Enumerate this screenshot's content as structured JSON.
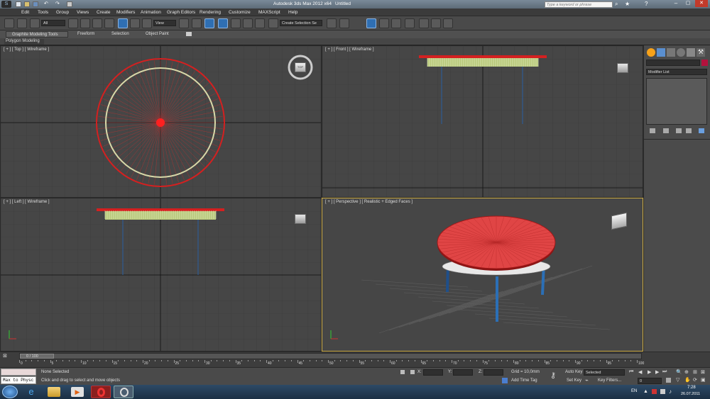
{
  "title": {
    "app": "Autodesk 3ds Max  2012 x64",
    "doc": "Untitled",
    "search_placeholder": "Type a keyword or phrase"
  },
  "menu": [
    "Edit",
    "Tools",
    "Group",
    "Views",
    "Create",
    "Modifiers",
    "Animation",
    "Graph Editors",
    "Rendering",
    "Customize",
    "MAXScript",
    "Help"
  ],
  "toolbar": {
    "selection_filter": "All",
    "ref_coord": "View",
    "named_selection": "Create Selection Se"
  },
  "ribbon": {
    "tabs": [
      "Graphite Modeling Tools",
      "Freeform",
      "Selection",
      "Object Paint"
    ],
    "panel": "Polygon Modeling"
  },
  "viewports": {
    "top": "[ + ] [ Top ] [ Wireframe ]",
    "front": "[ + ] [ Front ] [ Wireframe ]",
    "left": "[ + ] [ Left ] [ Wireframe ]",
    "persp": "[ + ] [ Perspective ] [ Realistic + Edged Faces ]"
  },
  "viewcube": {
    "top": "TOP"
  },
  "command_panel": {
    "modifier_list": "Modifier List"
  },
  "timeline": {
    "frame": "0 / 100",
    "ticks": [
      "0",
      "5",
      "10",
      "15",
      "20",
      "25",
      "30",
      "35",
      "40",
      "45",
      "50",
      "55",
      "60",
      "65",
      "70",
      "75",
      "80",
      "85",
      "90",
      "95",
      "100"
    ]
  },
  "status": {
    "maxscript": "Max to Physc",
    "selected": "None Selected",
    "prompt": "Click and drag to select and move objects",
    "x_label": "X:",
    "y_label": "Y:",
    "z_label": "Z:",
    "grid": "Grid = 10,0mm",
    "add_time_tag": "Add Time Tag",
    "auto_key": "Auto Key",
    "set_key": "Set Key",
    "key_mode": "Selected",
    "key_filters": "Key Filters...",
    "frame_field": "0"
  },
  "taskbar": {
    "lang": "EN",
    "time": "7:28",
    "date": "26.07.2011"
  },
  "colors": {
    "accent_red": "#d42020",
    "table_red": "#e04545",
    "leg_blue": "#2b6fb6",
    "active_border": "#cfae47"
  }
}
